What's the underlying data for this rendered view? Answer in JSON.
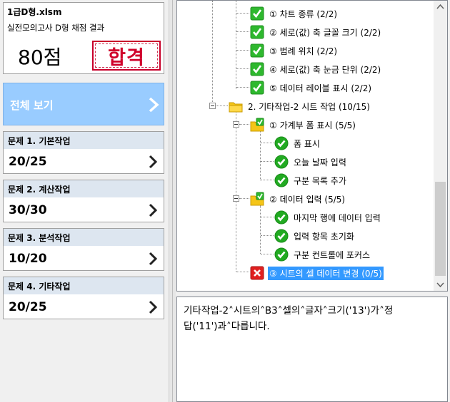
{
  "file": {
    "name": "1급D형.xlsm",
    "subtitle": "실전모의고사 D형 채점 결과",
    "score": "80점",
    "stamp": "합격"
  },
  "view_all": {
    "label": "전체 보기"
  },
  "questions": [
    {
      "title": "문제 1. 기본작업",
      "score": "20/25"
    },
    {
      "title": "문제 2. 계산작업",
      "score": "30/30"
    },
    {
      "title": "문제 3. 분석작업",
      "score": "10/20"
    },
    {
      "title": "문제 4. 기타작업",
      "score": "20/25"
    }
  ],
  "tree": {
    "items": [
      {
        "label": "① 차트 종류 (2/2)",
        "icon": "check-box-icon"
      },
      {
        "label": "② 세로(값) 축 글꼴 크기 (2/2)",
        "icon": "check-box-icon"
      },
      {
        "label": "③ 범례 위치 (2/2)",
        "icon": "check-box-icon"
      },
      {
        "label": "④ 세로(값) 축 눈금 단위 (2/2)",
        "icon": "check-box-icon"
      },
      {
        "label": "⑤ 데이터 레이블 표시 (2/2)",
        "icon": "check-box-icon"
      },
      {
        "label": "2. 기타작업-2 시트 작업 (10/15)",
        "icon": "folder-icon"
      },
      {
        "label": "① 가계부 폼 표시 (5/5)",
        "icon": "folder-check-icon"
      },
      {
        "label": "폼 표시",
        "icon": "check-circle-icon"
      },
      {
        "label": "오늘 날짜 입력",
        "icon": "check-circle-icon"
      },
      {
        "label": "구분 목록 추가",
        "icon": "check-circle-icon"
      },
      {
        "label": "② 데이터 입력 (5/5)",
        "icon": "folder-check-icon"
      },
      {
        "label": "마지막 행에 데이터 입력",
        "icon": "check-circle-icon"
      },
      {
        "label": "입력 항목 초기화",
        "icon": "check-circle-icon"
      },
      {
        "label": "구분 컨트롤에 포커스",
        "icon": "check-circle-icon"
      },
      {
        "label": "③ 시트의 셀 데이터 변경 (0/5)",
        "icon": "x-box-icon"
      }
    ]
  },
  "message": {
    "line1": "기타작업-2˄시트의˄B3˄셀의˄글자˄크기('13')가˄정",
    "line2": "답('11')과˄다릅니다."
  },
  "colors": {
    "accent": "#99ccff",
    "selection": "#3399ff",
    "check": "#22aa22",
    "error": "#e02020",
    "stamp": "#d0002a"
  }
}
